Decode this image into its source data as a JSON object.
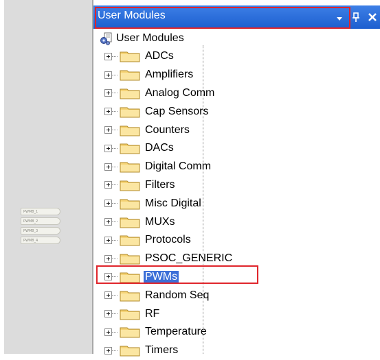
{
  "window": {
    "title": "User Modules"
  },
  "tree": {
    "root_label": "User Modules",
    "items": [
      {
        "label": "ADCs"
      },
      {
        "label": "Amplifiers"
      },
      {
        "label": "Analog Comm"
      },
      {
        "label": "Cap Sensors"
      },
      {
        "label": "Counters"
      },
      {
        "label": "DACs"
      },
      {
        "label": "Digital Comm"
      },
      {
        "label": "Filters"
      },
      {
        "label": "Misc Digital"
      },
      {
        "label": "MUXs"
      },
      {
        "label": "Protocols"
      },
      {
        "label": "PSOC_GENERIC"
      },
      {
        "label": "PWMs",
        "selected": true
      },
      {
        "label": "Random Seq"
      },
      {
        "label": "RF"
      },
      {
        "label": "Temperature"
      },
      {
        "label": "Timers"
      }
    ]
  },
  "canvas": {
    "mini_nodes": [
      "PWM8_1",
      "PWM8_2",
      "PWM8_3",
      "PWM8_4"
    ]
  },
  "icons": {
    "root": "user-modules-icon",
    "folder": "folder-icon",
    "expand": "plus-expander-icon",
    "dropdown": "dropdown-arrow-icon",
    "pin": "pin-icon",
    "close": "close-icon"
  },
  "colors": {
    "titlebar": "#2a6ad9",
    "highlight": "#e0252b",
    "folder": "#f5d376",
    "selection": "#3c6fd8"
  }
}
